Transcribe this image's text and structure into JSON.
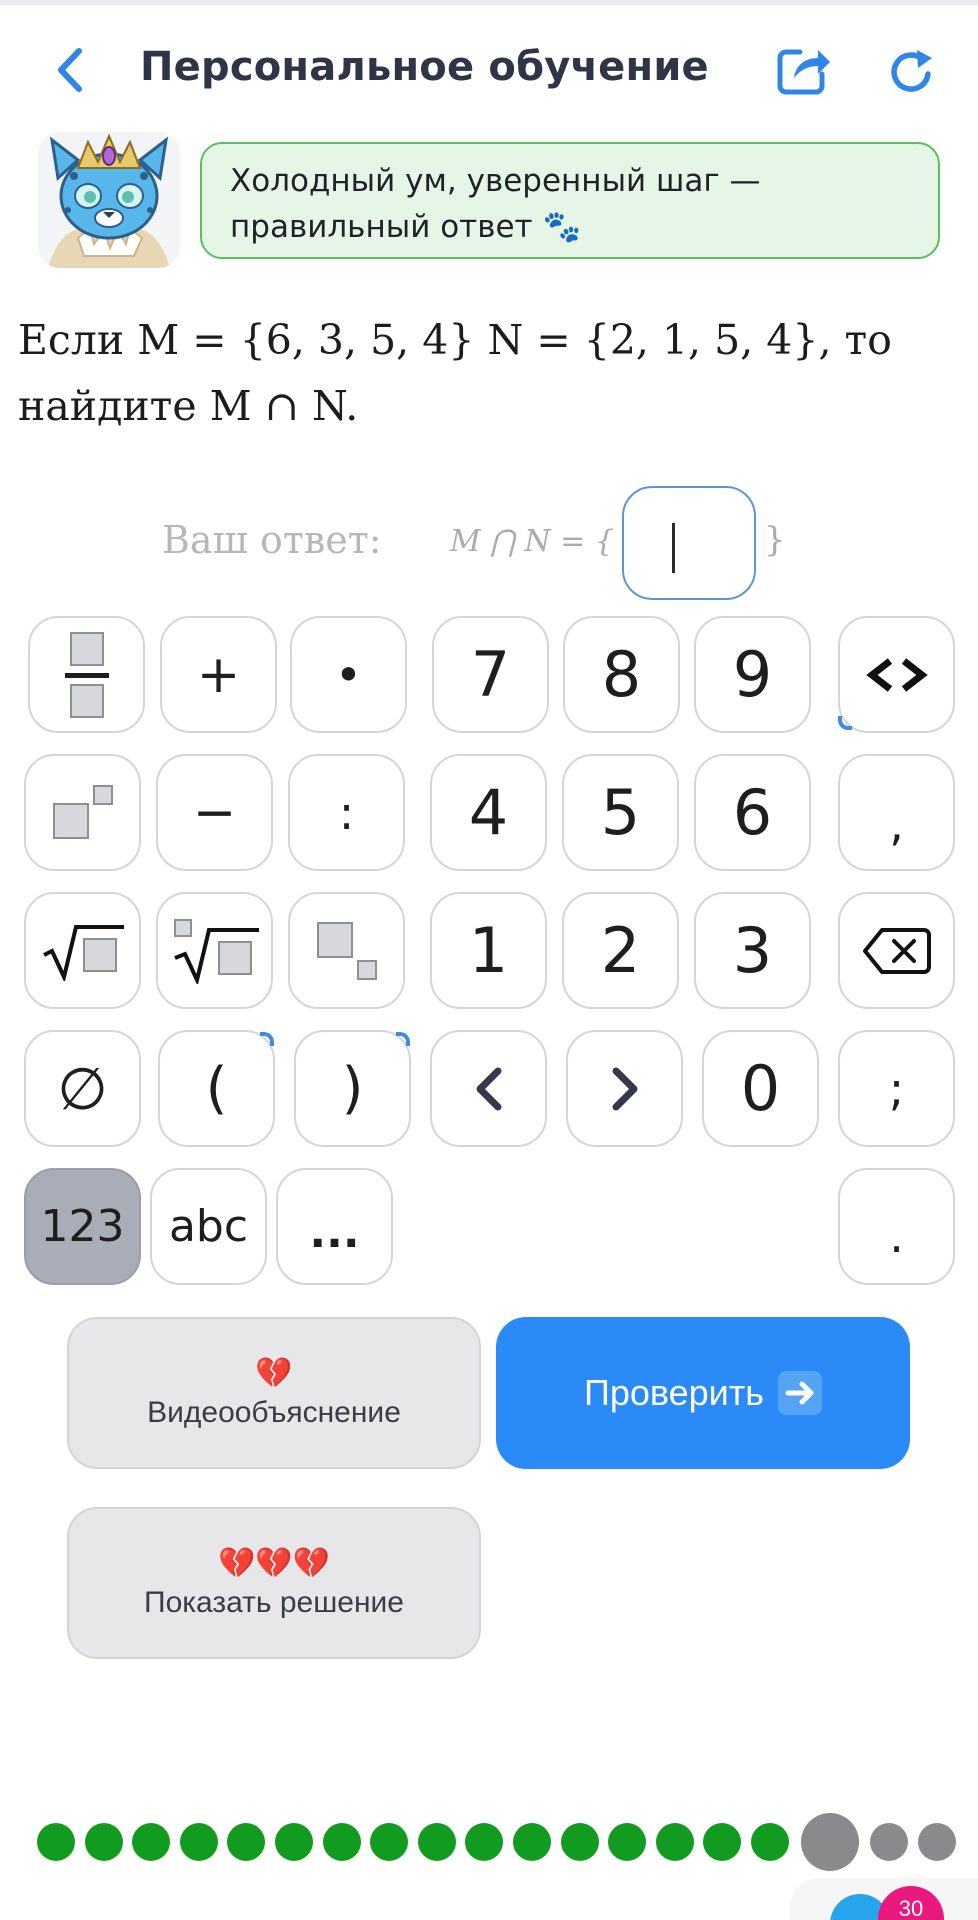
{
  "header": {
    "title": "Персональное обучение",
    "back_icon": "chevron-left-icon",
    "share_icon": "share-icon",
    "refresh_icon": "refresh-icon",
    "accent_color": "#2a8af7"
  },
  "bubble": {
    "line1": "Холодный ум, уверенный шаг —",
    "line2": "правильный ответ 🐾"
  },
  "question": {
    "line1": "Если M = {6, 3, 5, 4} N = {2, 1, 5, 4}, то",
    "line2": "найдите M ∩ N."
  },
  "answer": {
    "label": "Ваш ответ:",
    "expression": "M ⋂ N = {",
    "closing": "}",
    "value": ""
  },
  "keypad": {
    "rows": [
      [
        "fraction",
        "+",
        "•",
        "7",
        "8",
        "9",
        "<>"
      ],
      [
        "power",
        "−",
        ":",
        "4",
        "5",
        "6",
        ","
      ],
      [
        "sqrt",
        "nthroot",
        "subscript",
        "1",
        "2",
        "3",
        "backspace"
      ],
      [
        "∅",
        "(",
        ")",
        "<",
        ">",
        "0",
        ";"
      ],
      [
        "123",
        "abc",
        "…",
        ".",
        ""
      ]
    ],
    "labels": {
      "plus": "+",
      "dot": "•",
      "seven": "7",
      "eight": "8",
      "nine": "9",
      "tags": "<>",
      "minus": "−",
      "colon": ":",
      "four": "4",
      "five": "5",
      "six": "6",
      "comma": ",",
      "one": "1",
      "two": "2",
      "three": "3",
      "empty_set": "∅",
      "lparen": "(",
      "rparen": ")",
      "zero": "0",
      "semicolon": ";",
      "mode_numeric": "123",
      "mode_letters": "abc",
      "more": "...",
      "period": "."
    },
    "active_mode": "123"
  },
  "actions": {
    "video_label": "Видеообъяснение",
    "video_emoji": "💔",
    "check_label": "Проверить",
    "check_icon": "arrow-right-icon",
    "solution_label": "Показать решение",
    "solution_emoji": "💔💔💔"
  },
  "progress": {
    "completed": 16,
    "current": 17,
    "total": 19,
    "completed_color": "#119c1f",
    "pending_color": "#8a8a8c"
  },
  "badge": {
    "count": "30"
  }
}
